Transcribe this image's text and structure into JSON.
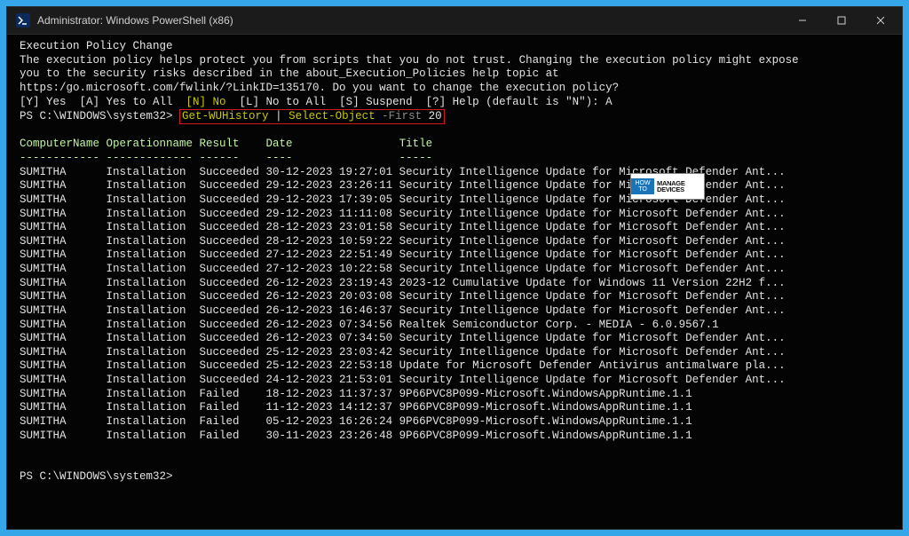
{
  "window": {
    "title": "Administrator: Windows PowerShell (x86)"
  },
  "policy": {
    "heading": "Execution Policy Change",
    "line1": "The execution policy helps protect you from scripts that you do not trust. Changing the execution policy might expose",
    "line2": "you to the security risks described in the about_Execution_Policies help topic at",
    "line3": "https:/go.microsoft.com/fwlink/?LinkID=135170. Do you want to change the execution policy?",
    "choices_pre": "[Y] Yes  [A] Yes to All  ",
    "choice_n": "[N] No",
    "choices_mid": "  [L] No to All  [S] Suspend  [?] Help (default is \"N\"): ",
    "answer": "A"
  },
  "prompt": {
    "ps1": "PS C:\\WINDOWS\\system32> ",
    "cmd_a": "Get-WUHistory",
    "cmd_pipe": " | ",
    "cmd_b": "Select-Object",
    "cmd_param": " -First ",
    "cmd_val": "20",
    "ps2": "PS C:\\WINDOWS\\system32>"
  },
  "table": {
    "headers": [
      "ComputerName",
      "Operationname",
      "Result",
      "Date",
      "Title"
    ],
    "dashes": [
      "------------",
      "-------------",
      "------",
      "----",
      "-----"
    ],
    "rows": [
      {
        "c": "SUMITHA",
        "o": "Installation",
        "r": "Succeeded",
        "d": "30-12-2023 19:27:01",
        "t": "Security Intelligence Update for Microsoft Defender Ant..."
      },
      {
        "c": "SUMITHA",
        "o": "Installation",
        "r": "Succeeded",
        "d": "29-12-2023 23:26:11",
        "t": "Security Intelligence Update for Microsoft Defender Ant..."
      },
      {
        "c": "SUMITHA",
        "o": "Installation",
        "r": "Succeeded",
        "d": "29-12-2023 17:39:05",
        "t": "Security Intelligence Update for Microsoft Defender Ant..."
      },
      {
        "c": "SUMITHA",
        "o": "Installation",
        "r": "Succeeded",
        "d": "29-12-2023 11:11:08",
        "t": "Security Intelligence Update for Microsoft Defender Ant..."
      },
      {
        "c": "SUMITHA",
        "o": "Installation",
        "r": "Succeeded",
        "d": "28-12-2023 23:01:58",
        "t": "Security Intelligence Update for Microsoft Defender Ant..."
      },
      {
        "c": "SUMITHA",
        "o": "Installation",
        "r": "Succeeded",
        "d": "28-12-2023 10:59:22",
        "t": "Security Intelligence Update for Microsoft Defender Ant..."
      },
      {
        "c": "SUMITHA",
        "o": "Installation",
        "r": "Succeeded",
        "d": "27-12-2023 22:51:49",
        "t": "Security Intelligence Update for Microsoft Defender Ant..."
      },
      {
        "c": "SUMITHA",
        "o": "Installation",
        "r": "Succeeded",
        "d": "27-12-2023 10:22:58",
        "t": "Security Intelligence Update for Microsoft Defender Ant..."
      },
      {
        "c": "SUMITHA",
        "o": "Installation",
        "r": "Succeeded",
        "d": "26-12-2023 23:19:43",
        "t": "2023-12 Cumulative Update for Windows 11 Version 22H2 f..."
      },
      {
        "c": "SUMITHA",
        "o": "Installation",
        "r": "Succeeded",
        "d": "26-12-2023 20:03:08",
        "t": "Security Intelligence Update for Microsoft Defender Ant..."
      },
      {
        "c": "SUMITHA",
        "o": "Installation",
        "r": "Succeeded",
        "d": "26-12-2023 16:46:37",
        "t": "Security Intelligence Update for Microsoft Defender Ant..."
      },
      {
        "c": "SUMITHA",
        "o": "Installation",
        "r": "Succeeded",
        "d": "26-12-2023 07:34:56",
        "t": "Realtek Semiconductor Corp. - MEDIA - 6.0.9567.1"
      },
      {
        "c": "SUMITHA",
        "o": "Installation",
        "r": "Succeeded",
        "d": "26-12-2023 07:34:50",
        "t": "Security Intelligence Update for Microsoft Defender Ant..."
      },
      {
        "c": "SUMITHA",
        "o": "Installation",
        "r": "Succeeded",
        "d": "25-12-2023 23:03:42",
        "t": "Security Intelligence Update for Microsoft Defender Ant..."
      },
      {
        "c": "SUMITHA",
        "o": "Installation",
        "r": "Succeeded",
        "d": "25-12-2023 22:53:18",
        "t": "Update for Microsoft Defender Antivirus antimalware pla..."
      },
      {
        "c": "SUMITHA",
        "o": "Installation",
        "r": "Succeeded",
        "d": "24-12-2023 21:53:01",
        "t": "Security Intelligence Update for Microsoft Defender Ant..."
      },
      {
        "c": "SUMITHA",
        "o": "Installation",
        "r": "Failed",
        "d": "18-12-2023 11:37:37",
        "t": "9P66PVC8P099-Microsoft.WindowsAppRuntime.1.1"
      },
      {
        "c": "SUMITHA",
        "o": "Installation",
        "r": "Failed",
        "d": "11-12-2023 14:12:37",
        "t": "9P66PVC8P099-Microsoft.WindowsAppRuntime.1.1"
      },
      {
        "c": "SUMITHA",
        "o": "Installation",
        "r": "Failed",
        "d": "05-12-2023 16:26:24",
        "t": "9P66PVC8P099-Microsoft.WindowsAppRuntime.1.1"
      },
      {
        "c": "SUMITHA",
        "o": "Installation",
        "r": "Failed",
        "d": "30-11-2023 23:26:48",
        "t": "9P66PVC8P099-Microsoft.WindowsAppRuntime.1.1"
      }
    ]
  },
  "badge": {
    "howto": "HOW\nTO",
    "mg_line1": "MANAGE",
    "mg_line2": "DEVICES"
  }
}
